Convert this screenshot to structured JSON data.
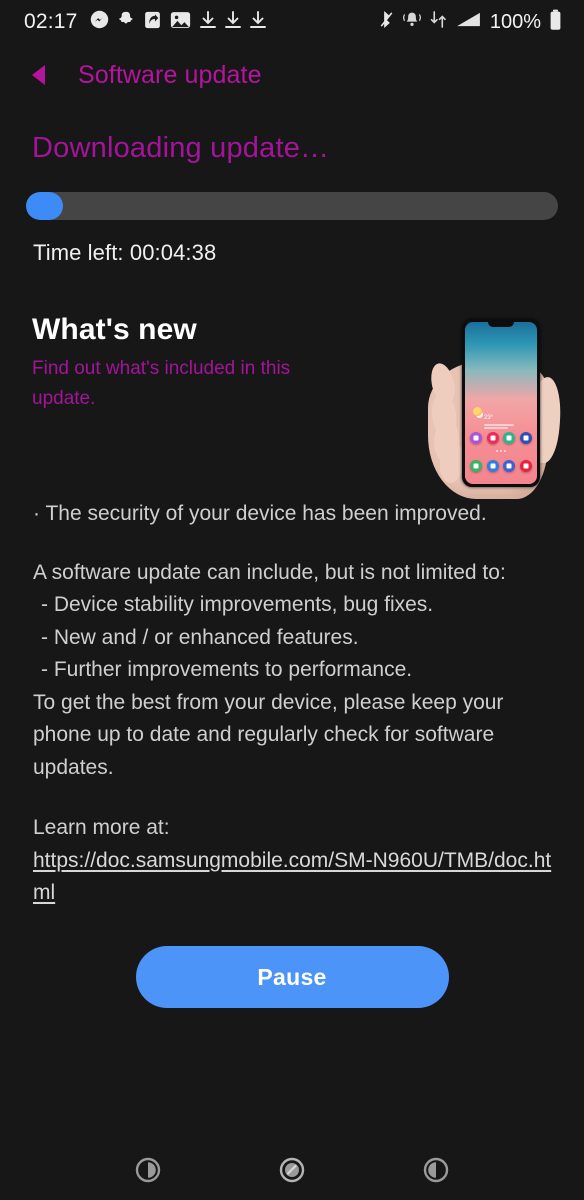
{
  "status_bar": {
    "clock": "02:17",
    "battery_percent": "100%",
    "left_icons": [
      "messenger-icon",
      "snapchat-ghost-icon",
      "share-arrow-icon",
      "gallery-image-icon",
      "download-arrow-icon",
      "download-arrow-icon",
      "download-arrow-icon"
    ],
    "right_icons": [
      "bluetooth-muted-icon",
      "vibrate-bell-icon",
      "data-transfer-icon",
      "signal-strength-icon",
      "battery-icon"
    ]
  },
  "header": {
    "back_icon": "back-triangle-icon",
    "title": "Software update",
    "accent_color": "#b5149f"
  },
  "download": {
    "title": "Downloading update…",
    "progress_percent": 7,
    "progress_fill_color": "#3d8bf7",
    "progress_track_color": "#454545",
    "time_left_label": "Time left: 00:04:38"
  },
  "whats_new": {
    "heading": "What's new",
    "subtitle": "Find out what's included in this update.",
    "subtitle_color": "#a4149a",
    "illustration": {
      "name": "hand-holding-phone-illustration",
      "phone_weather_temp": "23°",
      "app_icon_colors_row1": [
        "#a855d8",
        "#ee2a5b",
        "#2bb58a",
        "#2f4fb5"
      ],
      "app_icon_colors_row2": [
        "#36b663",
        "#2f7fe0",
        "#3b63d4",
        "#e8233f"
      ]
    }
  },
  "release_notes": {
    "bullet_security": "· The security of your device has been improved.",
    "intro": "A software update can include, but is not limited to:",
    "items": [
      "- Device stability improvements, bug fixes.",
      "- New and / or enhanced features.",
      "- Further improvements to performance."
    ],
    "closing": "To get the best from your device, please keep your phone up to date and regularly check for software updates.",
    "learn_more_label": "Learn more at:",
    "learn_more_url": "https://doc.samsungmobile.com/SM-N960U/TMB/doc.html"
  },
  "actions": {
    "pause_label": "Pause",
    "pause_color": "#4d94f8"
  },
  "nav_bar": {
    "recents_icon": "recents-circle-icon",
    "home_icon": "home-circle-icon",
    "back_icon": "back-circle-icon"
  }
}
